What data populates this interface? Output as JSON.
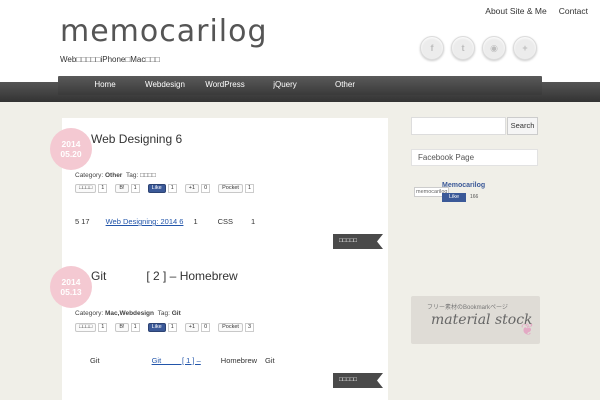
{
  "header": {
    "logo": "memocarilog",
    "tagline": "Web□□□□□iPhone□Mac□□□",
    "top_links": [
      "About Site & Me",
      "Contact"
    ],
    "social_icons": [
      "facebook-icon",
      "twitter-icon",
      "rss-icon",
      "plus-icon"
    ],
    "social_glyphs": [
      "f",
      "t",
      "◉",
      "+"
    ]
  },
  "nav": {
    "items": [
      "Home",
      "Webdesign",
      "WordPress",
      "jQuery",
      "Other"
    ]
  },
  "posts": [
    {
      "date_line1": "2014",
      "date_line2": "05.20",
      "title": "Web Designing 6",
      "category_label": "Category:",
      "category_value": "Other",
      "tag_label": "Tag:",
      "tag_value": "□□□□",
      "tweet_label": "□□□□",
      "tweet_count": "1",
      "hatena_count": "1",
      "fb_like": "Like",
      "fb_count": "1",
      "gplus": "+1",
      "gplus_count": "0",
      "pocket": "Pocket",
      "pocket_count": "1",
      "body_a": "5 17",
      "body_link": "Web Designing: 2014 6",
      "body_b": "1",
      "body_c": "CSS",
      "body_d": "1",
      "more": "□□□□□"
    },
    {
      "date_line1": "2014",
      "date_line2": "05.13",
      "title": "Git            [ 2 ] – Homebrew",
      "category_label": "Category:",
      "category_value": "Mac,Webdesign",
      "tag_label": "Tag:",
      "tag_value": "Git",
      "tweet_label": "□□□□",
      "tweet_count": "1",
      "hatena_count": "1",
      "fb_like": "Like",
      "fb_count": "1",
      "gplus": "+1",
      "gplus_count": "0",
      "pocket": "Pocket",
      "pocket_count": "3",
      "body_a": "Git",
      "body_link": "Git          [ 1 ] –",
      "body_b": "Homebrew",
      "body_c": "Git",
      "more": "□□□□□"
    }
  ],
  "sidebar": {
    "search_placeholder": "",
    "search_button": "Search",
    "facebook_title": "Facebook Page",
    "fb_page_name": "Memocarilog",
    "fb_logo_text": "memocarilog",
    "fb_like": "Like",
    "fb_count": "166",
    "banner_sub": "フリー素材のBookmarkページ",
    "banner_main": "material stock"
  },
  "colors": {
    "accent_pink": "#f4c9d2",
    "nav_dark": "#3a3a3a",
    "facebook_blue": "#3b5998"
  }
}
